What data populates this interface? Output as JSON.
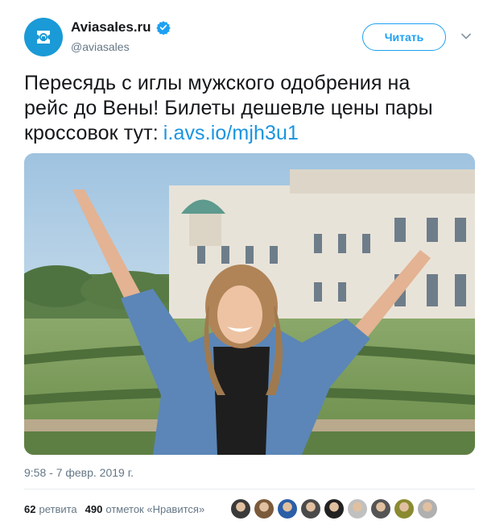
{
  "header": {
    "display_name": "Aviasales.ru",
    "handle": "@aviasales",
    "follow_label": "Читать",
    "verified_icon": "verified-badge-icon",
    "more_icon": "chevron-down-icon",
    "accent_color": "#1da1f2"
  },
  "tweet": {
    "text_line1": "Пересядь с иглы мужского одобрения на",
    "text_line2": "рейс до Вены! Билеты дешевле цены пары",
    "text_line3_prefix": "кроссовок тут:",
    "link": "i.avs.io/mjh3u1"
  },
  "meta": {
    "timestamp": "9:58 - 7 февр. 2019 г.",
    "retweets_count": "62",
    "retweets_label": "ретвита",
    "likes_count": "490",
    "likes_label": "отметок «Нравится»"
  },
  "likers": [
    "#3a3a3a",
    "#7a5a3a",
    "#2b5fa8",
    "#4a4a4a",
    "#222222",
    "#c0c0c0",
    "#555555",
    "#8a8a30",
    "#b0b0b0"
  ]
}
